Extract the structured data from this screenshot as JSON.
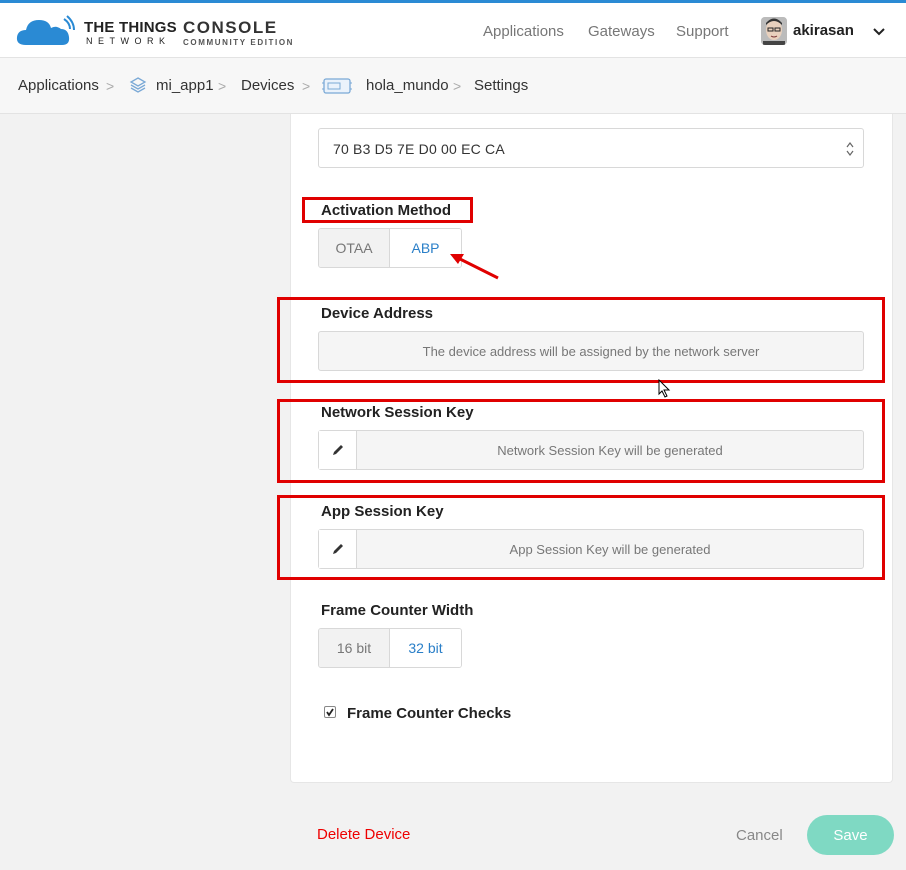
{
  "header": {
    "brand_line1": "THE THINGS",
    "brand_line2": "NETWORK",
    "console_title": "CONSOLE",
    "console_edition": "COMMUNITY EDITION",
    "nav": [
      "Applications",
      "Gateways",
      "Support"
    ],
    "username": "akirasan"
  },
  "breadcrumb": {
    "items": [
      "Applications",
      "mi_app1",
      "Devices",
      "hola_mundo",
      "Settings"
    ],
    "separator": ">"
  },
  "form": {
    "app_eui_value": "70 B3 D5 7E D0 00 EC CA",
    "activation_method": {
      "label": "Activation Method",
      "options": [
        "OTAA",
        "ABP"
      ],
      "selected": "ABP"
    },
    "device_address": {
      "label": "Device Address",
      "placeholder": "The device address will be assigned by the network server"
    },
    "network_session_key": {
      "label": "Network Session Key",
      "placeholder": "Network Session Key will be generated"
    },
    "app_session_key": {
      "label": "App Session Key",
      "placeholder": "App Session Key will be generated"
    },
    "frame_counter_width": {
      "label": "Frame Counter Width",
      "options": [
        "16 bit",
        "32 bit"
      ],
      "selected": "32 bit"
    },
    "frame_counter_checks": {
      "label": "Frame Counter Checks",
      "checked": true
    }
  },
  "actions": {
    "delete_label": "Delete Device",
    "cancel_label": "Cancel",
    "save_label": "Save"
  },
  "colors": {
    "accent_blue": "#2a7fc8",
    "annotation_red": "#e00000",
    "save_button": "#7fd9c3"
  }
}
